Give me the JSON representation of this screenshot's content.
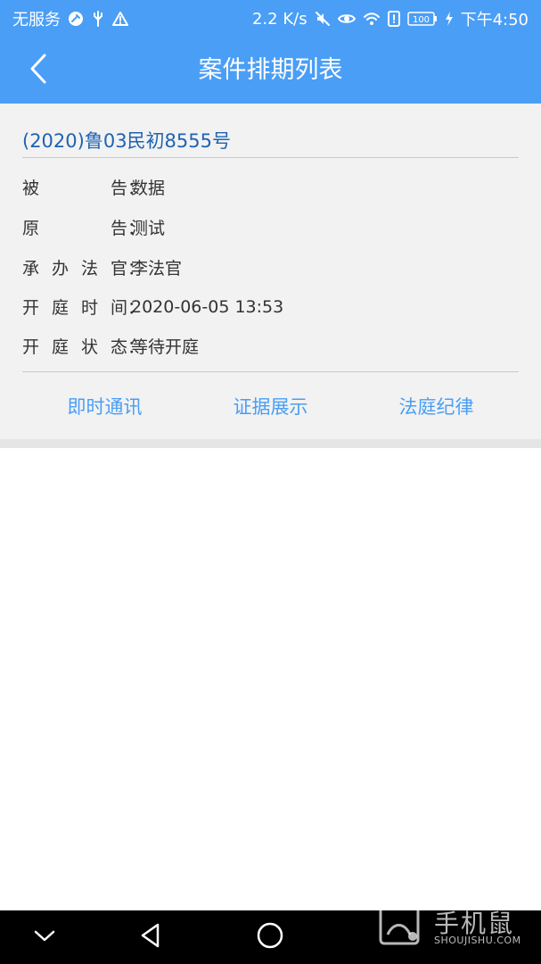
{
  "status_bar": {
    "left_text": "无服务",
    "network_speed": "2.2 K/s",
    "battery": "100",
    "time": "下午4:50",
    "icons": [
      "wrench-icon",
      "usb-icon",
      "warning-icon",
      "mute-icon",
      "eye-icon",
      "wifi-icon",
      "phone-alert-icon",
      "battery-icon",
      "charging-icon"
    ]
  },
  "header": {
    "title": "案件排期列表",
    "back_icon": "chevron-left-icon"
  },
  "case": {
    "number": "(2020)鲁03民初8555号",
    "fields": [
      {
        "label_chars": [
          "被",
          "告"
        ],
        "value": "数据"
      },
      {
        "label_chars": [
          "原",
          "告"
        ],
        "value": "测试"
      },
      {
        "label_chars": [
          "承",
          "办",
          "法",
          "官"
        ],
        "value": "李法官"
      },
      {
        "label_chars": [
          "开",
          "庭",
          "时",
          "间"
        ],
        "value": "2020-06-05 13:53"
      },
      {
        "label_chars": [
          "开",
          "庭",
          "状",
          "态"
        ],
        "value": "等待开庭"
      }
    ],
    "colon": "：",
    "actions": [
      {
        "label": "即时通讯"
      },
      {
        "label": "证据展示"
      },
      {
        "label": "法庭纪律"
      }
    ]
  },
  "navigation": {
    "icons": [
      "collapse-icon",
      "back-triangle-icon",
      "home-circle-icon"
    ]
  },
  "watermark": {
    "text": "手机鼠",
    "subtext": "SHOUJISHU.COM"
  },
  "colors": {
    "accent": "#4a9ef5",
    "case_number": "#1f63b3",
    "card_bg": "#f2f2f2",
    "nav_bg": "#000000"
  }
}
